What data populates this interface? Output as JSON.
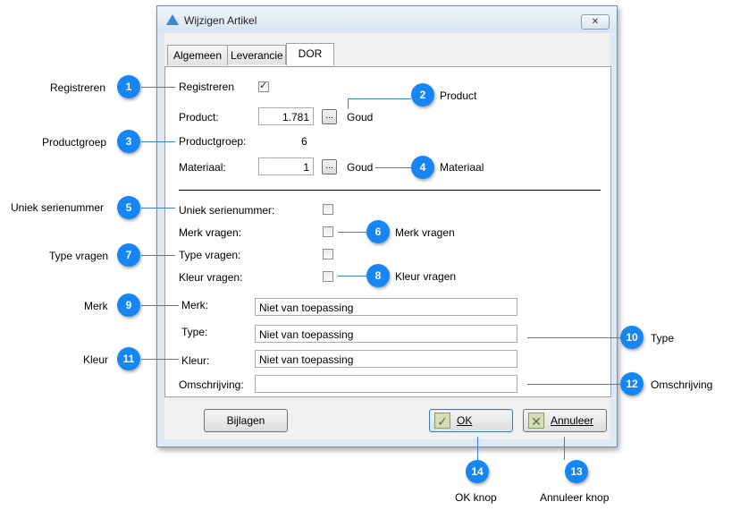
{
  "dialog": {
    "title": "Wijzigen Artikel",
    "close_glyph": "✕",
    "tabs": [
      {
        "label": "Algemeen"
      },
      {
        "label": "Leverancie"
      },
      {
        "label": "DOR"
      }
    ],
    "fields": {
      "registreren_label": "Registreren",
      "registreren_checked": true,
      "product_label": "Product:",
      "product_value": "1.781",
      "product_name": "Goud",
      "productgroep_label": "Productgroep:",
      "productgroep_value": "6",
      "materiaal_label": "Materiaal:",
      "materiaal_value": "1",
      "materiaal_name": "Goud",
      "dots_label": "...",
      "uniek_label": "Uniek serienummer:",
      "merk_vragen_label": "Merk vragen:",
      "type_vragen_label": "Type vragen:",
      "kleur_vragen_label": "Kleur vragen:",
      "merk_label": "Merk:",
      "merk_value": "Niet van toepassing",
      "type_label": "Type:",
      "type_value": "Niet van toepassing",
      "kleur_label": "Kleur:",
      "kleur_value": "Niet van toepassing",
      "omschrijving_label": "Omschrijving:",
      "omschrijving_value": ""
    },
    "buttons": {
      "bijlagen": "Bijlagen",
      "ok": "OK",
      "annuleer": "Annuleer"
    }
  },
  "callouts": [
    {
      "num": "1",
      "label": "Registreren"
    },
    {
      "num": "2",
      "label": "Product"
    },
    {
      "num": "3",
      "label": "Productgroep"
    },
    {
      "num": "4",
      "label": "Materiaal"
    },
    {
      "num": "5",
      "label": "Uniek serienummer"
    },
    {
      "num": "6",
      "label": "Merk vragen"
    },
    {
      "num": "7",
      "label": "Type vragen"
    },
    {
      "num": "8",
      "label": "Kleur vragen"
    },
    {
      "num": "9",
      "label": "Merk"
    },
    {
      "num": "10",
      "label": "Type"
    },
    {
      "num": "11",
      "label": "Kleur"
    },
    {
      "num": "12",
      "label": "Omschrijving"
    },
    {
      "num": "13",
      "label": "Annuleer knop"
    },
    {
      "num": "14",
      "label": "OK knop"
    }
  ],
  "colors": {
    "badge": "#1786f5",
    "leader_line": "#3a7fd0",
    "dialog_frame": "#dfe9f5"
  },
  "icons": [
    "app-icon",
    "close-icon",
    "check-icon",
    "cancel-icon",
    "checkbox-checked-icon"
  ]
}
